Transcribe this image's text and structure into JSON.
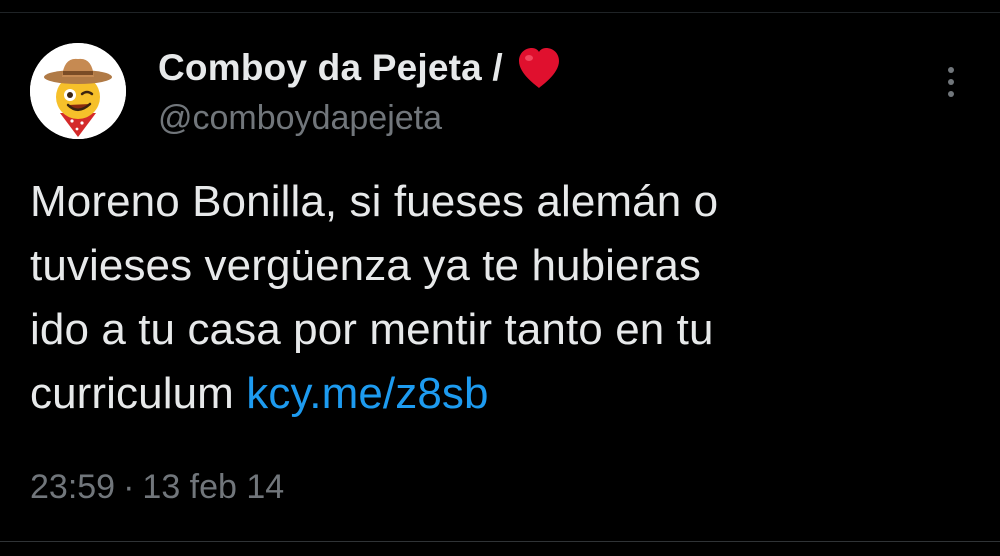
{
  "tweet": {
    "author": {
      "display_name": "Comboy da Pejeta /",
      "name_emoji": "heart-icon",
      "handle": "@comboydapejeta",
      "avatar": "cowboy-emoji-avatar"
    },
    "text_lines": [
      "Moreno Bonilla, si fueses alemán o",
      "tuvieses vergüenza ya te hubieras",
      "ido a tu casa por mentir tanto en tu",
      "curriculum"
    ],
    "link": "kcy.me/z8sb",
    "time": "23:59",
    "separator": "·",
    "date": "13 feb 14"
  },
  "colors": {
    "background": "#000000",
    "text_primary": "#e7e9ea",
    "text_secondary": "#71767b",
    "link": "#1d9bf0",
    "heart": "#e0102e"
  }
}
